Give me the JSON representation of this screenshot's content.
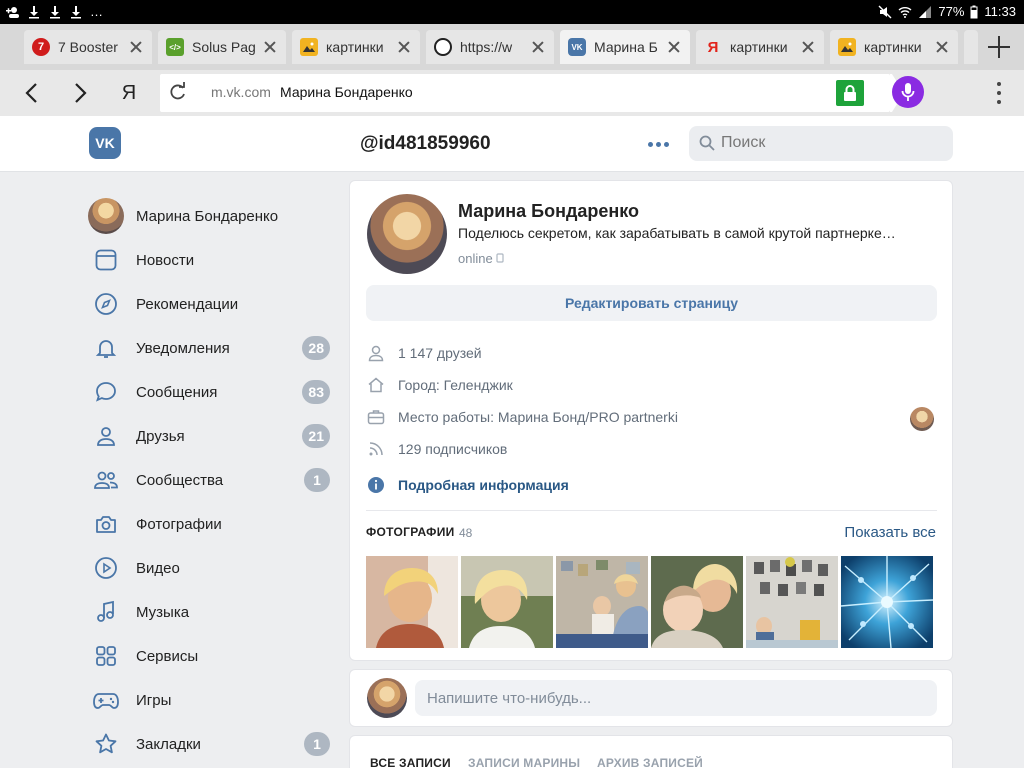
{
  "status_bar": {
    "notifications": "…",
    "battery": "77%",
    "time": "11:33"
  },
  "tabs": [
    {
      "title": "7 Booster",
      "favicon": "7",
      "favicon_color": "#d01c1c"
    },
    {
      "title": "Solus Pag",
      "favicon": "</>",
      "favicon_color": "#5aa02c"
    },
    {
      "title": "картинки",
      "favicon": "image-icon",
      "favicon_color": "#f1b321"
    },
    {
      "title": "https://w",
      "favicon": "q-icon",
      "favicon_color": "#222222"
    },
    {
      "title": "Марина Б",
      "favicon": "VK",
      "favicon_color": "#4a76a8",
      "active": true
    },
    {
      "title": "картинки",
      "favicon": "Я",
      "favicon_color": "#e2231a"
    },
    {
      "title": "картинки",
      "favicon": "image-icon",
      "favicon_color": "#f1b321"
    }
  ],
  "addressbar": {
    "yandex_letter": "Я",
    "domain": "m.vk.com",
    "page_title": "Марина Бондаренко"
  },
  "header": {
    "logo": "VK",
    "profile_id": "@id481859960",
    "search_placeholder": "Поиск"
  },
  "sidebar": {
    "user_name": "Марина Бондаренко",
    "items": [
      {
        "label": "Новости",
        "icon": "news-icon",
        "count": ""
      },
      {
        "label": "Рекомендации",
        "icon": "compass-icon",
        "count": ""
      },
      {
        "label": "Уведомления",
        "icon": "bell-icon",
        "count": "28"
      },
      {
        "label": "Сообщения",
        "icon": "message-icon",
        "count": "83"
      },
      {
        "label": "Друзья",
        "icon": "user-icon",
        "count": "21"
      },
      {
        "label": "Сообщества",
        "icon": "users-icon",
        "count": "1"
      },
      {
        "label": "Фотографии",
        "icon": "camera-icon",
        "count": ""
      },
      {
        "label": "Видео",
        "icon": "play-icon",
        "count": ""
      },
      {
        "label": "Музыка",
        "icon": "music-icon",
        "count": ""
      },
      {
        "label": "Сервисы",
        "icon": "grid-icon",
        "count": ""
      },
      {
        "label": "Игры",
        "icon": "gamepad-icon",
        "count": ""
      },
      {
        "label": "Закладки",
        "icon": "star-icon",
        "count": "1"
      }
    ]
  },
  "profile": {
    "name": "Марина Бондаренко",
    "status": "Поделюсь секретом, как зарабатывать в самой крутой партнерке…",
    "online": "online",
    "edit_button": "Редактировать страницу",
    "info": {
      "friends": "1 147 друзей",
      "city": "Город: Геленджик",
      "work": "Место работы: Марина Бонд/PRO partnerki",
      "followers": "129 подписчиков",
      "more": "Подробная информация"
    },
    "photos": {
      "title": "ФОТОГРАФИИ",
      "count": "48",
      "show_all": "Показать все"
    }
  },
  "composer": {
    "placeholder": "Напишите что-нибудь..."
  },
  "wall_tabs": [
    {
      "label": "ВСЕ ЗАПИСИ",
      "active": true
    },
    {
      "label": "ЗАПИСИ МАРИНЫ",
      "active": false
    },
    {
      "label": "АРХИВ ЗАПИСЕЙ",
      "active": false
    }
  ],
  "colors": {
    "vk_blue": "#4a76a8",
    "link_blue": "#2a5885",
    "badge_gray": "#aeb7c2",
    "lock_green": "#1ea33a",
    "mic_purple": "#8a2be2"
  }
}
